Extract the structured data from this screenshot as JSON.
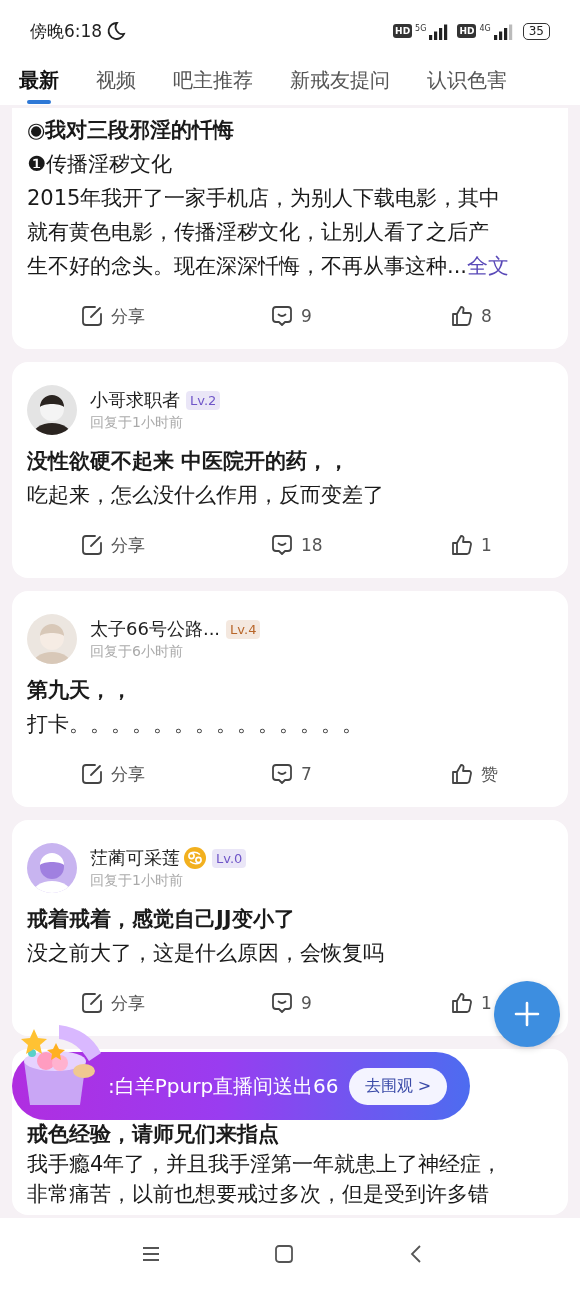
{
  "status_bar": {
    "time": "傍晚6:18",
    "sims": [
      {
        "hd": "HD",
        "network": "5G"
      },
      {
        "hd": "HD",
        "network": "4G"
      }
    ],
    "battery": "35"
  },
  "tabs": [
    {
      "label": "最新",
      "selected": true
    },
    {
      "label": "视频",
      "selected": false
    },
    {
      "label": "吧主推荐",
      "selected": false
    },
    {
      "label": "新戒友提问",
      "selected": false
    },
    {
      "label": "认识色害",
      "selected": false
    }
  ],
  "posts": [
    {
      "title": "◉我对三段邪淫的忏悔",
      "lines": [
        "❶传播淫秽文化",
        "2015年我开了一家手机店，为别人下载电影，其中",
        "就有黄色电影，传播淫秽文化，让别人看了之后产",
        "生不好的念头。现在深深忏悔，不再从事这种..."
      ],
      "more_link": "全文",
      "actions": {
        "share": "分享",
        "comments": "9",
        "likes": "8"
      }
    },
    {
      "author": {
        "name": "小哥求职者",
        "zodiac_badge": false,
        "level": {
          "text": "Lv.2",
          "color": "#6f55c8"
        },
        "time": "回复于1小时前"
      },
      "title": "没性欲硬不起来 中医院开的药，，",
      "lines": [
        "吃起来，怎么没什么作用，反而变差了"
      ],
      "actions": {
        "share": "分享",
        "comments": "18",
        "likes": "1"
      }
    },
    {
      "author": {
        "name": "太子66号公路...",
        "zodiac_badge": false,
        "level": {
          "text": "Lv.4",
          "color": "#b8662a"
        },
        "time": "回复于6小时前"
      },
      "title": "第九天，，",
      "lines": [
        "打卡。。。。。。。。。。。。。。"
      ],
      "actions": {
        "share": "分享",
        "comments": "7",
        "likes": "赞"
      }
    },
    {
      "author": {
        "name": "茳蔺可采莲",
        "zodiac_badge": true,
        "level": {
          "text": "Lv.0",
          "color": "#6f55c8"
        },
        "time": "回复于1小时前"
      },
      "title": "戒着戒着，感觉自己JJ变小了",
      "lines": [
        "没之前大了，这是什么原因，会恢复吗"
      ],
      "actions": {
        "share": "分享",
        "comments": "9",
        "likes": "1"
      }
    },
    {
      "title": "戒色经验，请师兄们来指点",
      "lines": [
        "我手瘾4年了，并且我手淫第一年就患上了神经症，",
        "非常痛苦，以前也想要戒过多次，但是受到许多错"
      ]
    }
  ],
  "banner": {
    "text": ":白羊Ppurp直播间送出66",
    "button": "去围观 >"
  }
}
